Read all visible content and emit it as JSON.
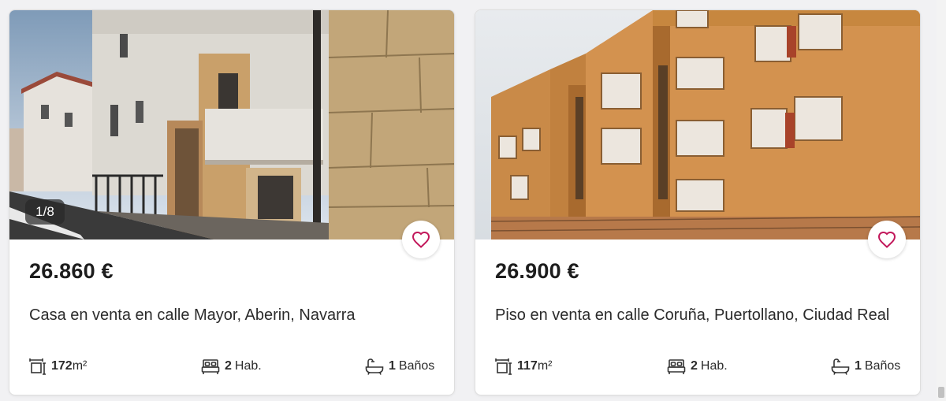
{
  "listings": [
    {
      "photo_counter": "1/8",
      "price": "26.860 €",
      "title": "Casa en venta en calle Mayor, Aberin, Navarra",
      "area_value": "172",
      "area_unit": "m²",
      "rooms_value": "2",
      "rooms_label": "Hab.",
      "baths_value": "1",
      "baths_label": "Baños",
      "favorite_icon": "heart-outline-icon"
    },
    {
      "price": "26.900 €",
      "title": "Piso en venta en calle Coruña, Puertollano, Ciudad Real",
      "area_value": "117",
      "area_unit": "m²",
      "rooms_value": "2",
      "rooms_label": "Hab.",
      "baths_value": "1",
      "baths_label": "Baños",
      "favorite_icon": "heart-outline-icon"
    }
  ],
  "colors": {
    "accent": "#c2185b",
    "text": "#1d1d1d",
    "card_border": "#dedede",
    "background": "#f1f1f3"
  }
}
